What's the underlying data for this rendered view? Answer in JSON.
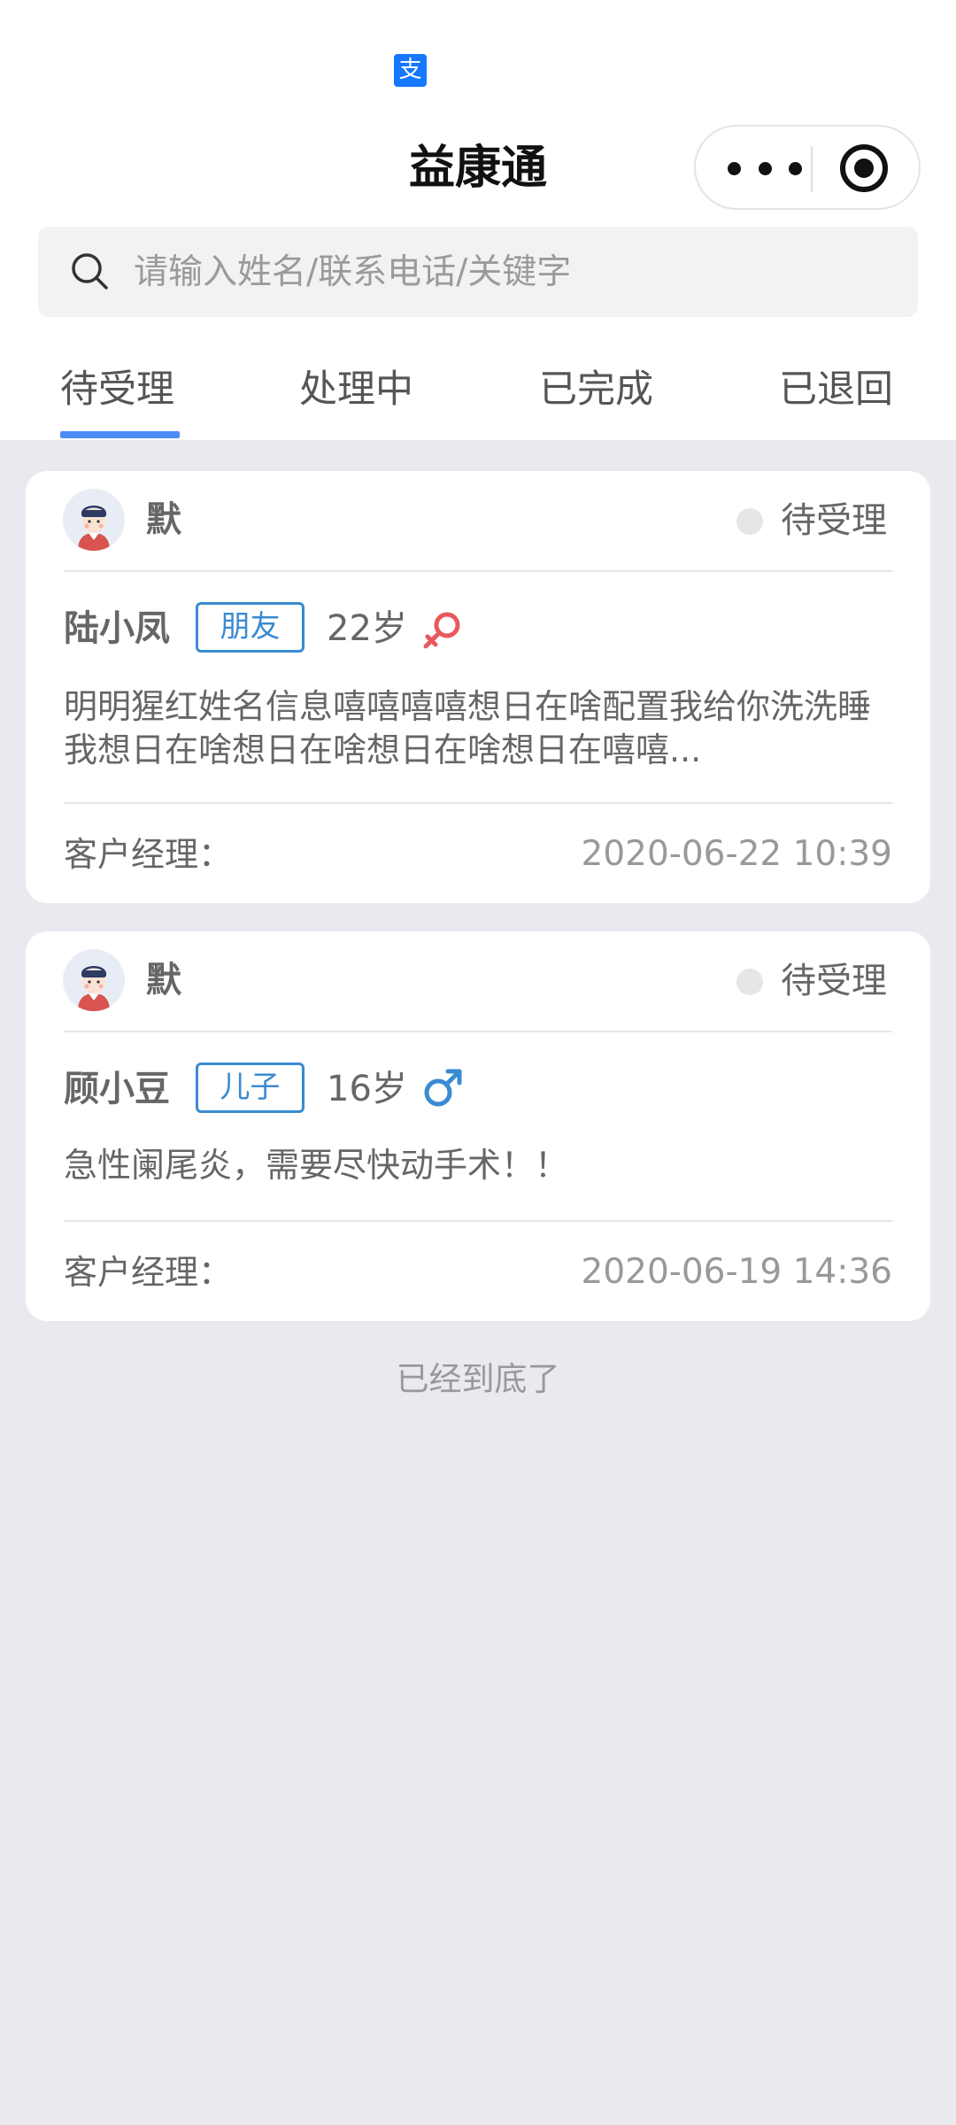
{
  "app": {
    "title": "益康通",
    "platform_logo_char": "支"
  },
  "search": {
    "placeholder": "请输入姓名/联系电话/关键字",
    "value": ""
  },
  "tabs": [
    {
      "label": "待受理",
      "active": true
    },
    {
      "label": "处理中",
      "active": false
    },
    {
      "label": "已完成",
      "active": false
    },
    {
      "label": "已退回",
      "active": false
    }
  ],
  "records": [
    {
      "user_name": "默",
      "status": "待受理",
      "patient_name": "陆小凤",
      "relation": "朋友",
      "age": "22岁",
      "gender": "female",
      "description": "明明猩红姓名信息嘻嘻嘻嘻想日在啥配置我给你洗洗睡我想日在啥想日在啥想日在啥想日在嘻嘻...",
      "manager_label": "客户经理：",
      "time": "2020-06-22 10:39"
    },
    {
      "user_name": "默",
      "status": "待受理",
      "patient_name": "顾小豆",
      "relation": "儿子",
      "age": "16岁",
      "gender": "male",
      "description": "急性阑尾炎，需要尽快动手术！！",
      "manager_label": "客户经理：",
      "time": "2020-06-19 14:36"
    }
  ],
  "footer": {
    "end_text": "已经到底了"
  },
  "colors": {
    "accent": "#4c8cf5",
    "relation_tag": "#3a8bd1",
    "female_icon": "#e8595e",
    "male_icon": "#3a8bd1",
    "page_bg": "#e9e9ef"
  }
}
